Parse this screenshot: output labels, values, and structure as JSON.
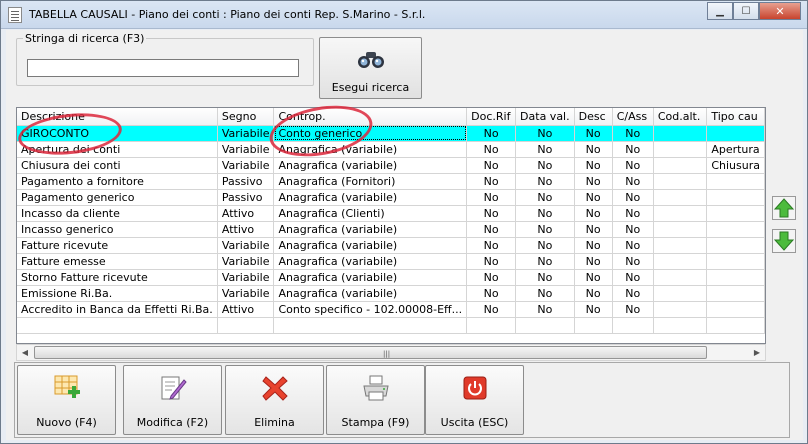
{
  "window": {
    "title": "TABELLA CAUSALI - Piano dei conti : Piano dei conti Rep. S.Marino - S.r.l."
  },
  "search": {
    "legend": "Stringa di ricerca (F3)",
    "value": "",
    "button_label": "Esegui ricerca"
  },
  "grid": {
    "columns": [
      "Descrizione",
      "Segno",
      "Controp.",
      "Doc.Rif",
      "Data val.",
      "Desc",
      "C/Ass",
      "Cod.alt.",
      "Tipo cau"
    ],
    "rows": [
      [
        "GIROCONTO",
        "Variabile",
        "Conto generico",
        "No",
        "No",
        "No",
        "No",
        "",
        ""
      ],
      [
        "Apertura dei conti",
        "Variabile",
        "Anagrafica (variabile)",
        "No",
        "No",
        "No",
        "No",
        "",
        "Apertura"
      ],
      [
        "Chiusura dei conti",
        "Variabile",
        "Anagrafica (variabile)",
        "No",
        "No",
        "No",
        "No",
        "",
        "Chiusura"
      ],
      [
        "Pagamento a fornitore",
        "Passivo",
        "Anagrafica (Fornitori)",
        "No",
        "No",
        "No",
        "No",
        "",
        ""
      ],
      [
        "Pagamento generico",
        "Passivo",
        "Anagrafica (variabile)",
        "No",
        "No",
        "No",
        "No",
        "",
        ""
      ],
      [
        "Incasso da cliente",
        "Attivo",
        "Anagrafica (Clienti)",
        "No",
        "No",
        "No",
        "No",
        "",
        ""
      ],
      [
        "Incasso generico",
        "Attivo",
        "Anagrafica (variabile)",
        "No",
        "No",
        "No",
        "No",
        "",
        ""
      ],
      [
        "Fatture ricevute",
        "Variabile",
        "Anagrafica (variabile)",
        "No",
        "No",
        "No",
        "No",
        "",
        ""
      ],
      [
        "Fatture emesse",
        "Variabile",
        "Anagrafica (variabile)",
        "No",
        "No",
        "No",
        "No",
        "",
        ""
      ],
      [
        "Storno Fatture ricevute",
        "Variabile",
        "Anagrafica (variabile)",
        "No",
        "No",
        "No",
        "No",
        "",
        ""
      ],
      [
        "Emissione Ri.Ba.",
        "Variabile",
        "Anagrafica (variabile)",
        "No",
        "No",
        "No",
        "No",
        "",
        ""
      ],
      [
        "Accredito in Banca da Effetti Ri.Ba.",
        "Attivo",
        "Conto specifico - 102.00008-Eff...",
        "No",
        "No",
        "No",
        "No",
        "",
        ""
      ]
    ],
    "selected_row": 0
  },
  "toolbar": {
    "nuovo": "Nuovo (F4)",
    "modifica": "Modifica (F2)",
    "elimina": "Elimina",
    "stampa": "Stampa (F9)",
    "uscita": "Uscita (ESC)"
  },
  "colors": {
    "selection": "#00ffff",
    "annotation": "#dc283c",
    "arrow": "#3aa83a"
  }
}
